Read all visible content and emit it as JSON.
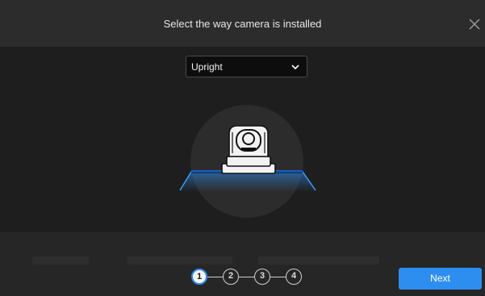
{
  "dialog": {
    "title": "Select the way camera is installed",
    "close_icon": "close-icon"
  },
  "install_select": {
    "selected": "Upright",
    "icon": "chevron-down-icon"
  },
  "illustration": {
    "icon": "ptz-camera-upright-icon"
  },
  "steps": {
    "items": [
      {
        "label": "1",
        "active": true
      },
      {
        "label": "2",
        "active": false
      },
      {
        "label": "3",
        "active": false
      },
      {
        "label": "4",
        "active": false
      }
    ]
  },
  "footer": {
    "next_label": "Next"
  },
  "colors": {
    "accent": "#2e8ef0",
    "header_bg": "#2c2c2c",
    "content_bg": "#1e1e1e",
    "footer_bg": "#262626"
  }
}
